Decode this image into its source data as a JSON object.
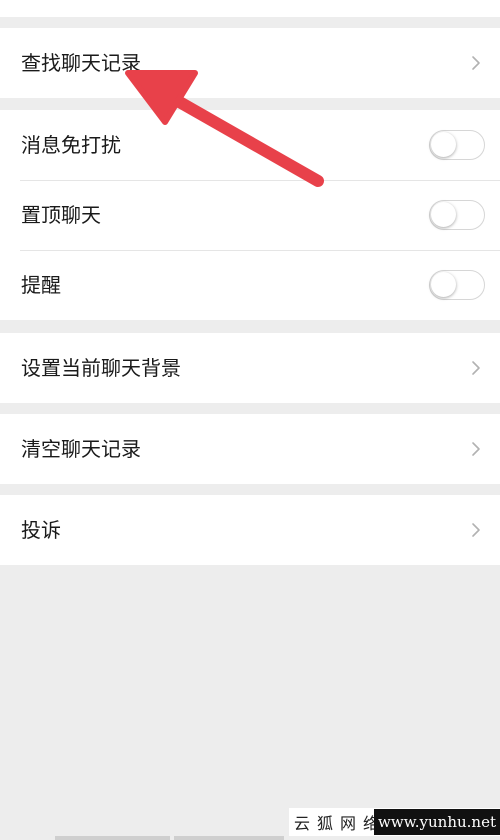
{
  "settings": {
    "groups": [
      {
        "rows": [
          {
            "label": "查找聊天记录",
            "control": "chevron"
          }
        ]
      },
      {
        "rows": [
          {
            "label": "消息免打扰",
            "control": "toggle",
            "checked": false
          },
          {
            "label": "置顶聊天",
            "control": "toggle",
            "checked": false
          },
          {
            "label": "提醒",
            "control": "toggle",
            "checked": false
          }
        ]
      },
      {
        "rows": [
          {
            "label": "设置当前聊天背景",
            "control": "chevron"
          }
        ]
      },
      {
        "rows": [
          {
            "label": "清空聊天记录",
            "control": "chevron"
          }
        ]
      },
      {
        "rows": [
          {
            "label": "投诉",
            "control": "chevron"
          }
        ]
      }
    ]
  },
  "watermark": {
    "site_name": "云狐网络",
    "url": "www.yunhu.net"
  },
  "colors": {
    "background": "#ededed",
    "row_background": "#ffffff",
    "text": "#1a1a1a",
    "divider": "#e5e5e5",
    "chevron": "#b2b2b2",
    "annotation_arrow": "#e8414a"
  },
  "icons": {
    "chevron": "chevron-right-icon",
    "annotation": "red-arrow-annotation-icon"
  }
}
